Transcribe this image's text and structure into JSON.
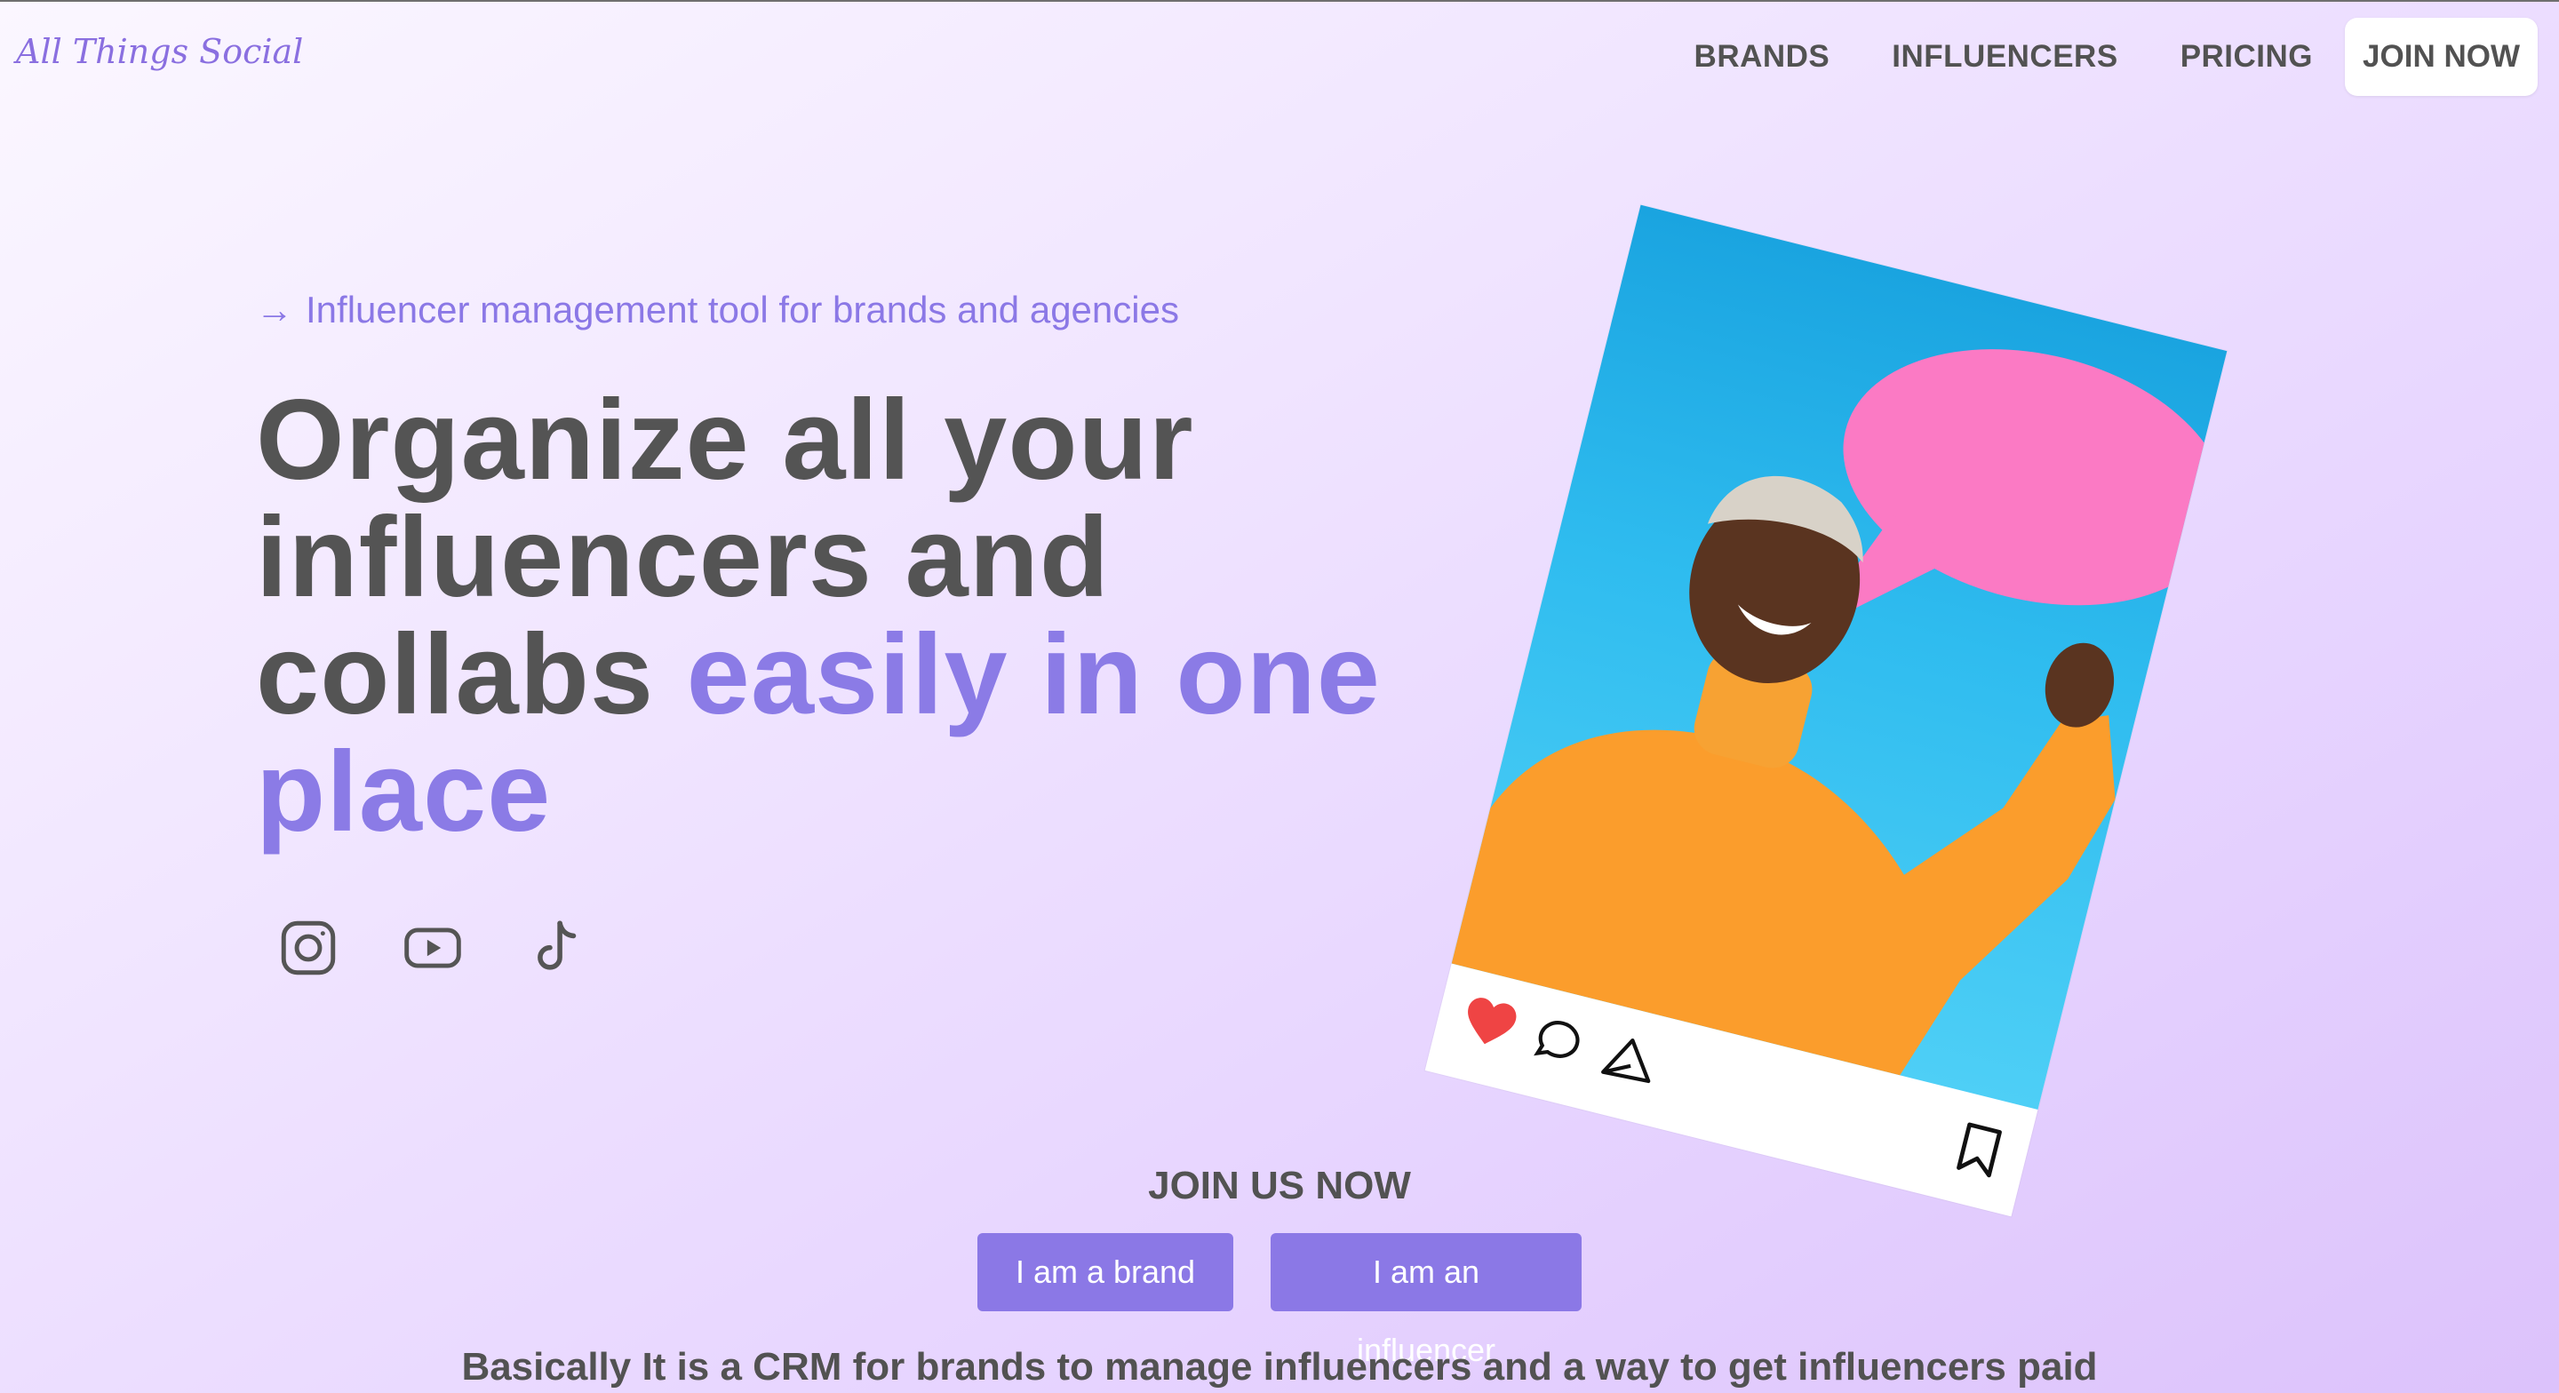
{
  "brand": {
    "logo_text": "All Things Social"
  },
  "nav": {
    "brands": "BRANDS",
    "influencers": "INFLUENCERS",
    "pricing": "PRICING",
    "join": "JOIN NOW"
  },
  "hero": {
    "tagline_arrow": "→",
    "tagline": "Influencer management tool for brands and agencies",
    "headline_plain": "Organize all your influencers and collabs ",
    "headline_accent": "easily in one place",
    "social_icons": [
      "instagram-icon",
      "youtube-icon",
      "tiktok-icon"
    ]
  },
  "post_card": {
    "action_icons": [
      "heart-icon",
      "comment-icon",
      "share-icon",
      "bookmark-icon"
    ],
    "image": "smiling woman in orange turtleneck holding pink speech bubble on blue background"
  },
  "join": {
    "title": "JOIN US NOW",
    "brand_button": "I am a brand",
    "influencer_button": "I am an influencer"
  },
  "summary": "Basically It is a CRM for brands to manage influencers and a way to get influencers paid",
  "colors": {
    "accent": "#8b78e6",
    "text": "#525252",
    "heart": "#ef4444",
    "bubble": "#fb7ac4",
    "sweater": "#fb9d2c"
  }
}
